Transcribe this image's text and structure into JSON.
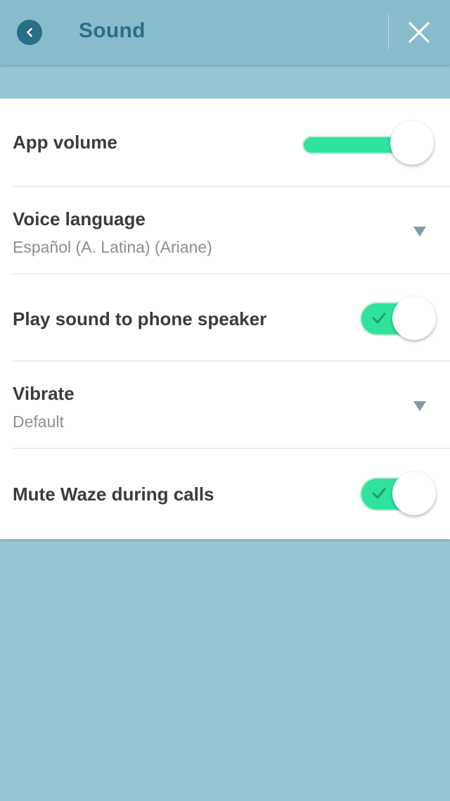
{
  "header": {
    "title": "Sound",
    "back_icon": "chevron-left-icon",
    "close_icon": "close-icon"
  },
  "settings": {
    "app_volume": {
      "label": "App volume",
      "level_percent": 100
    },
    "voice_language": {
      "label": "Voice language",
      "value": "Español (A. Latina) (Ariane)"
    },
    "play_sound_speaker": {
      "label": "Play sound to phone speaker",
      "enabled": true
    },
    "vibrate": {
      "label": "Vibrate",
      "value": "Default"
    },
    "mute_during_calls": {
      "label": "Mute Waze during calls",
      "enabled": true
    }
  },
  "colors": {
    "accent": "#2fe39c",
    "header": "#88bccd",
    "title": "#2a6e87",
    "background": "#97c6d5"
  }
}
